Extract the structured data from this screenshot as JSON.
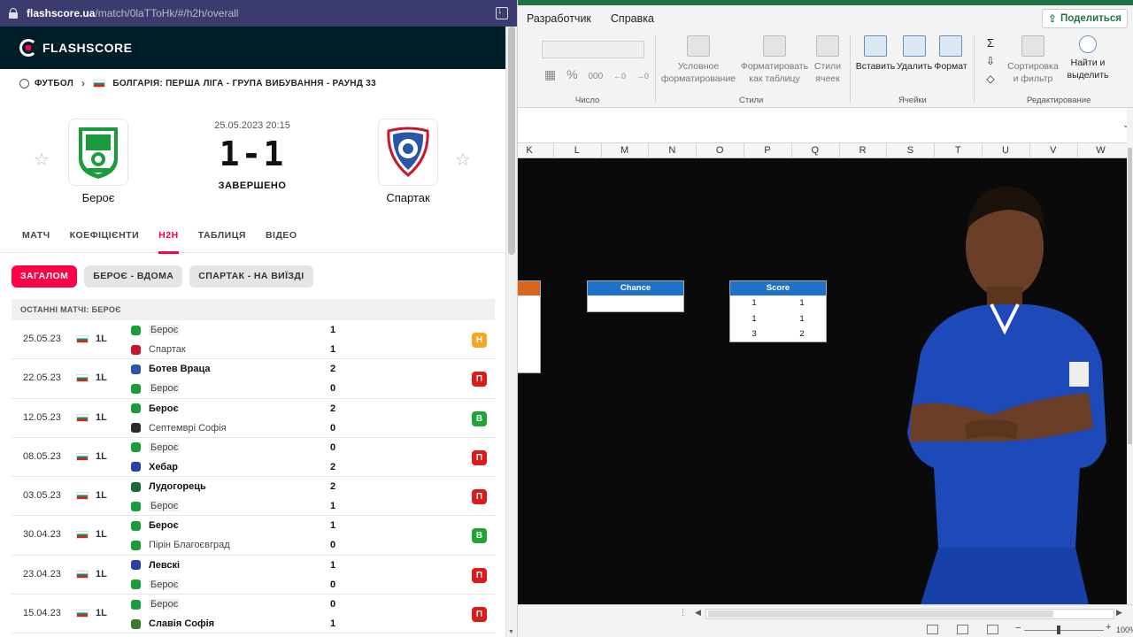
{
  "browser": {
    "url_host": "flashscore.ua",
    "url_path": "/match/0laTToHk/#/h2h/overall"
  },
  "flashscore": {
    "logo_text": "FLASHSCORE",
    "breadcrumb": {
      "sport": "ФУТБОЛ",
      "competition": "БОЛГАРІЯ: ПЕРША ЛІГА - ГРУПА ВИБУВАННЯ - РАУНД 33"
    },
    "match": {
      "datetime": "25.05.2023 20:15",
      "score": "1-1",
      "status": "ЗАВЕРШЕНО",
      "home_team": "Бероє",
      "away_team": "Спартак"
    },
    "tabs": [
      {
        "label": "МАТЧ"
      },
      {
        "label": "КОЕФІЦІЄНТИ"
      },
      {
        "label": "H2H"
      },
      {
        "label": "ТАБЛИЦЯ"
      },
      {
        "label": "ВІДЕО"
      }
    ],
    "filters": [
      {
        "label": "ЗАГАЛОМ"
      },
      {
        "label": "БЕРОЄ - ВДОМА"
      },
      {
        "label": "СПАРТАК - НА ВИЇЗДІ"
      }
    ],
    "section_title": "ОСТАННІ МАТЧІ: БЕРОЄ",
    "matches": [
      {
        "date": "25.05.23",
        "league": "1L",
        "home": "Бероє",
        "away": "Спартак",
        "home_score": "1",
        "away_score": "1",
        "result": "Н",
        "result_color": "#f5a623"
      },
      {
        "date": "22.05.23",
        "league": "1L",
        "home": "Ботев Враца",
        "away": "Бероє",
        "home_score": "2",
        "away_score": "0",
        "result": "П",
        "result_color": "#dc1a1a"
      },
      {
        "date": "12.05.23",
        "league": "1L",
        "home": "Бероє",
        "away": "Септемврі Софія",
        "home_score": "2",
        "away_score": "0",
        "result": "В",
        "result_color": "#1ea535"
      },
      {
        "date": "08.05.23",
        "league": "1L",
        "home": "Бероє",
        "away": "Хебар",
        "home_score": "0",
        "away_score": "2",
        "result": "П",
        "result_color": "#dc1a1a"
      },
      {
        "date": "03.05.23",
        "league": "1L",
        "home": "Лудогорець",
        "away": "Бероє",
        "home_score": "2",
        "away_score": "1",
        "result": "П",
        "result_color": "#dc1a1a"
      },
      {
        "date": "30.04.23",
        "league": "1L",
        "home": "Бероє",
        "away": "Пірін Благоєвград",
        "home_score": "1",
        "away_score": "0",
        "result": "В",
        "result_color": "#1ea535"
      },
      {
        "date": "23.04.23",
        "league": "1L",
        "home": "Левскі",
        "away": "Бероє",
        "home_score": "1",
        "away_score": "0",
        "result": "П",
        "result_color": "#dc1a1a"
      },
      {
        "date": "15.04.23",
        "league": "1L",
        "home": "Бероє",
        "away": "Славія Софія",
        "home_score": "0",
        "away_score": "1",
        "result": "П",
        "result_color": "#dc1a1a"
      }
    ]
  },
  "excel": {
    "ribbon_tabs": [
      "Разработчик",
      "Справка"
    ],
    "share_label": "Поделиться",
    "ribbon": {
      "group_number": "Число",
      "group_styles": "Стили",
      "group_cells": "Ячейки",
      "group_editing": "Редактирование",
      "cond_format": [
        "Условное",
        "форматирование"
      ],
      "format_table": [
        "Форматировать",
        "как таблицу"
      ],
      "cell_styles": [
        "Стили",
        "ячеек"
      ],
      "insert": "Вставить",
      "delete": "Удалить",
      "format": "Формат",
      "sort_filter": [
        "Сортировка",
        "и фильтр"
      ],
      "find_select": [
        "Найти и",
        "выделить"
      ]
    },
    "columns": [
      "K",
      "L",
      "M",
      "N",
      "O",
      "P",
      "Q",
      "R",
      "S",
      "T",
      "U",
      "V",
      "W"
    ],
    "chance_table": {
      "header": "Chance"
    },
    "score_table": {
      "header": "Score",
      "rows": [
        [
          "1",
          "1"
        ],
        [
          "1",
          "1"
        ],
        [
          "3",
          "2"
        ]
      ]
    },
    "zoom_label": "100%"
  },
  "colors": {
    "flashscore_red": "#ff0046",
    "flashscore_dark": "#001e28",
    "excel_green": "#217346",
    "table_header_blue": "#1f72c6"
  }
}
